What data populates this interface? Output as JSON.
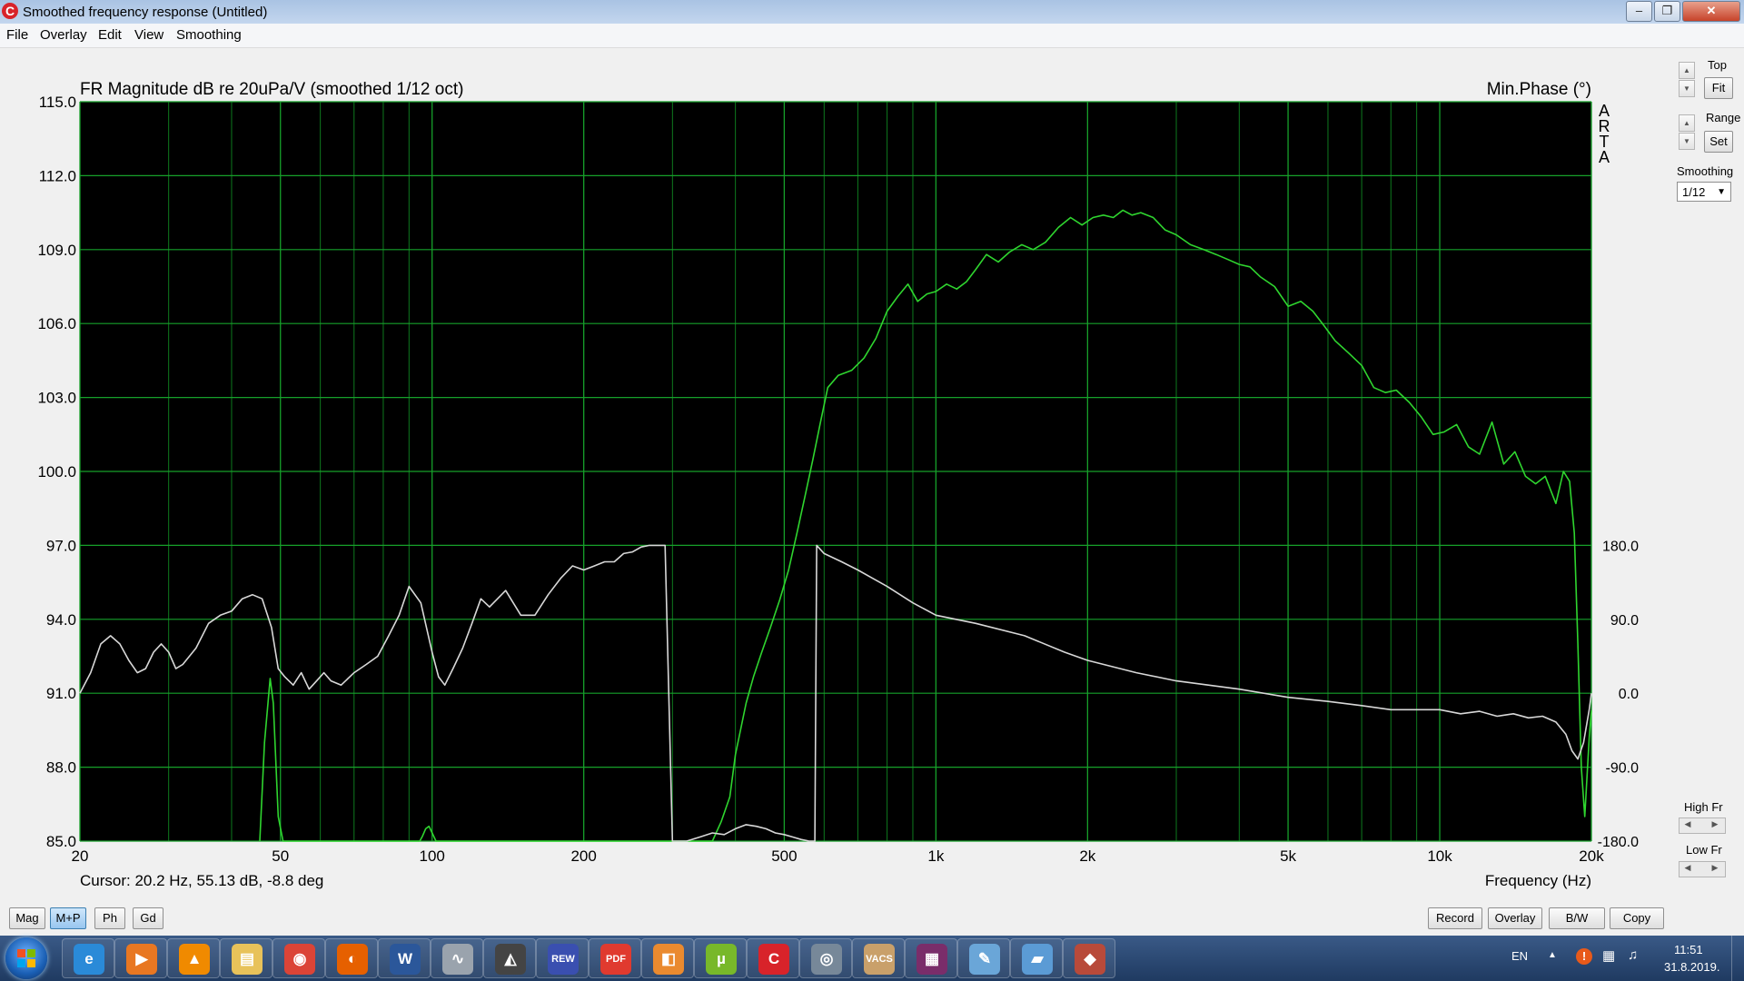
{
  "window": {
    "title": "Smoothed frequency response (Untitled)",
    "app_icon": "arta-c-icon",
    "controls": [
      "minimize-icon",
      "maximize-icon",
      "close-icon"
    ]
  },
  "menu": [
    "File",
    "Overlay",
    "Edit",
    "View",
    "Smoothing"
  ],
  "right_panel": {
    "top_label": "Top",
    "fit_button": "Fit",
    "range_label": "Range",
    "set_button": "Set",
    "smoothing_label": "Smoothing",
    "smoothing_value": "1/12",
    "high_fr_label": "High Fr",
    "low_fr_label": "Low Fr"
  },
  "bottom_left_buttons": [
    {
      "label": "Mag",
      "active": false
    },
    {
      "label": "M+P",
      "active": true
    },
    {
      "label": "Ph",
      "active": false
    },
    {
      "label": "Gd",
      "active": false
    }
  ],
  "bottom_right_buttons": [
    "Record",
    "Overlay",
    "B/W",
    "Copy"
  ],
  "taskbar": {
    "apps": [
      {
        "name": "internet-explorer-icon",
        "glyph": "e",
        "color": "#2a8ad8"
      },
      {
        "name": "media-player-icon",
        "glyph": "▶",
        "color": "#e87722"
      },
      {
        "name": "vlc-icon",
        "glyph": "▲",
        "color": "#f08a00"
      },
      {
        "name": "file-explorer-icon",
        "glyph": "▤",
        "color": "#e8c25a"
      },
      {
        "name": "chrome-icon",
        "glyph": "◉",
        "color": "#db4437"
      },
      {
        "name": "firefox-icon",
        "glyph": "◐",
        "color": "#e66000"
      },
      {
        "name": "word-icon",
        "glyph": "W",
        "color": "#2b579a"
      },
      {
        "name": "impulse-app-icon",
        "glyph": "∿",
        "color": "#9aa3ad"
      },
      {
        "name": "cat-app-icon",
        "glyph": "◭",
        "color": "#444444"
      },
      {
        "name": "rew-icon",
        "glyph": "REW",
        "color": "#3a4fb0"
      },
      {
        "name": "pdf-icon",
        "glyph": "PDF",
        "color": "#e03a2f"
      },
      {
        "name": "slides-icon",
        "glyph": "◧",
        "color": "#ea8a2f"
      },
      {
        "name": "utorrent-icon",
        "glyph": "µ",
        "color": "#78b82a"
      },
      {
        "name": "arta-icon",
        "glyph": "C",
        "color": "#d8232a"
      },
      {
        "name": "eye-app-icon",
        "glyph": "◎",
        "color": "#778899"
      },
      {
        "name": "vacs-icon",
        "glyph": "VACS",
        "color": "#c9a06a"
      },
      {
        "name": "winrar-icon",
        "glyph": "▦",
        "color": "#7a2d6a"
      },
      {
        "name": "paint-icon",
        "glyph": "✎",
        "color": "#6aa6d8"
      },
      {
        "name": "book-app-icon",
        "glyph": "▰",
        "color": "#5b9bd5"
      },
      {
        "name": "3d-app-icon",
        "glyph": "◆",
        "color": "#b84a3a"
      }
    ],
    "tray": {
      "language": "EN",
      "time": "11:51",
      "date": "31.8.2019."
    }
  },
  "chart_data": {
    "type": "line",
    "title": "FR Magnitude dB re 20uPa/V (smoothed 1/12 oct)",
    "right_title": "Min.Phase (°)",
    "watermark": "ARTA",
    "xlabel": "Frequency (Hz)",
    "x_scale": "log",
    "xlim": [
      20,
      20000
    ],
    "x_ticks": [
      {
        "value": 20,
        "label": "20"
      },
      {
        "value": 50,
        "label": "50"
      },
      {
        "value": 100,
        "label": "100"
      },
      {
        "value": 200,
        "label": "200"
      },
      {
        "value": 500,
        "label": "500"
      },
      {
        "value": 1000,
        "label": "1k"
      },
      {
        "value": 2000,
        "label": "2k"
      },
      {
        "value": 5000,
        "label": "5k"
      },
      {
        "value": 10000,
        "label": "10k"
      },
      {
        "value": 20000,
        "label": "20k"
      }
    ],
    "ylim": [
      85,
      115
    ],
    "y_ticks": [
      "115.0",
      "112.0",
      "109.0",
      "106.0",
      "103.0",
      "100.0",
      "97.0",
      "94.0",
      "91.0",
      "88.0",
      "85.0"
    ],
    "y2lim": [
      -180,
      180
    ],
    "y2_range_on_left_axis": [
      85,
      97
    ],
    "y2_ticks": [
      "180.0",
      "90.0",
      "0.0",
      "-90.0",
      "-180.0"
    ],
    "cursor_readout": "Cursor: 20.2 Hz, 55.13 dB, -8.8 deg",
    "grid": true,
    "background": "#000000",
    "grid_color": "#0e7a1e",
    "series": [
      {
        "role": "magnitude",
        "color": "#2fd52f",
        "x": [
          45.5,
          46.5,
          47.7,
          48.4,
          49.5,
          50.6,
          51.8,
          53.1,
          94.5,
          95.7,
          97.1,
          98.6,
          100.2,
          101.8,
          103.2,
          360,
          375,
          390,
          400,
          420,
          435,
          450,
          470,
          490,
          510,
          530,
          550,
          570,
          590,
          610,
          640,
          680,
          720,
          760,
          800,
          840,
          880,
          920,
          960,
          1000,
          1050,
          1100,
          1150,
          1200,
          1260,
          1330,
          1400,
          1480,
          1560,
          1650,
          1750,
          1850,
          1950,
          2050,
          2150,
          2250,
          2350,
          2450,
          2550,
          2700,
          2850,
          3000,
          3200,
          3400,
          3600,
          3800,
          4000,
          4200,
          4400,
          4700,
          5000,
          5300,
          5600,
          5900,
          6200,
          6600,
          7000,
          7400,
          7800,
          8200,
          8700,
          9200,
          9700,
          10200,
          10800,
          11400,
          12000,
          12700,
          13400,
          14100,
          14800,
          15500,
          16200,
          17000,
          17600,
          18100,
          18500,
          18800,
          19100,
          19400,
          19800,
          20000
        ],
        "y": [
          85.0,
          89.0,
          91.6,
          90.6,
          86.0,
          85.0,
          85.0,
          85.0,
          85.0,
          85.2,
          85.5,
          85.6,
          85.3,
          85.0,
          85.0,
          85.0,
          85.8,
          86.8,
          88.5,
          90.6,
          91.7,
          92.6,
          93.7,
          94.8,
          96.0,
          97.5,
          99.0,
          100.5,
          102.0,
          103.4,
          103.9,
          104.1,
          104.6,
          105.4,
          106.5,
          107.1,
          107.6,
          106.9,
          107.2,
          107.3,
          107.6,
          107.4,
          107.7,
          108.2,
          108.8,
          108.5,
          108.9,
          109.2,
          109.0,
          109.3,
          109.9,
          110.3,
          110.0,
          110.3,
          110.4,
          110.3,
          110.6,
          110.4,
          110.5,
          110.3,
          109.8,
          109.6,
          109.2,
          109.0,
          108.8,
          108.6,
          108.4,
          108.3,
          107.9,
          107.5,
          106.7,
          106.9,
          106.5,
          105.9,
          105.3,
          104.8,
          104.3,
          103.4,
          103.2,
          103.3,
          102.8,
          102.2,
          101.5,
          101.6,
          101.9,
          101.0,
          100.7,
          102.0,
          100.3,
          100.8,
          99.8,
          99.5,
          99.8,
          98.7,
          100.0,
          99.6,
          97.5,
          93.0,
          88.0,
          86.0,
          89.2,
          90.3
        ]
      },
      {
        "role": "phase",
        "color": "#d8d8d8",
        "x": [
          20,
          21,
          22,
          23,
          24,
          25,
          26,
          27,
          28,
          29,
          30,
          31,
          32,
          34,
          36,
          38,
          40,
          42,
          44,
          46,
          48,
          49.5,
          51,
          53,
          55,
          57,
          59,
          61,
          63,
          66,
          70,
          74,
          78,
          82,
          86,
          90,
          95,
          100,
          103,
          106,
          110,
          115,
          120,
          125,
          130,
          140,
          150,
          160,
          170,
          180,
          190,
          200,
          210,
          220,
          230,
          240,
          250,
          260,
          270,
          280,
          290,
          300,
          320,
          340,
          360,
          380,
          400,
          420,
          440,
          460,
          480,
          500,
          520,
          540,
          560,
          575,
          580,
          600,
          650,
          700,
          800,
          900,
          1000,
          1200,
          1500,
          1800,
          2000,
          2500,
          3000,
          4000,
          5000,
          6000,
          7000,
          8000,
          9000,
          10000,
          11000,
          12000,
          13000,
          14000,
          15000,
          16000,
          17000,
          17800,
          18300,
          18800,
          19300,
          19800,
          20000
        ],
        "y": [
          0,
          25,
          60,
          70,
          60,
          40,
          25,
          30,
          50,
          60,
          50,
          30,
          35,
          55,
          85,
          95,
          100,
          115,
          120,
          115,
          80,
          30,
          20,
          10,
          25,
          5,
          15,
          25,
          15,
          10,
          25,
          35,
          45,
          70,
          95,
          130,
          110,
          50,
          20,
          10,
          30,
          55,
          85,
          115,
          105,
          125,
          95,
          95,
          120,
          140,
          155,
          150,
          155,
          160,
          160,
          170,
          172,
          178,
          180,
          180,
          180,
          -180,
          -180,
          -175,
          -170,
          -172,
          -165,
          -160,
          -162,
          -165,
          -170,
          -172,
          -175,
          -178,
          -180,
          -180,
          180,
          170,
          160,
          150,
          130,
          110,
          95,
          85,
          70,
          50,
          40,
          25,
          15,
          5,
          -5,
          -10,
          -15,
          -20,
          -20,
          -20,
          -25,
          -22,
          -28,
          -25,
          -30,
          -28,
          -35,
          -50,
          -70,
          -80,
          -60,
          -20,
          0
        ]
      }
    ]
  }
}
